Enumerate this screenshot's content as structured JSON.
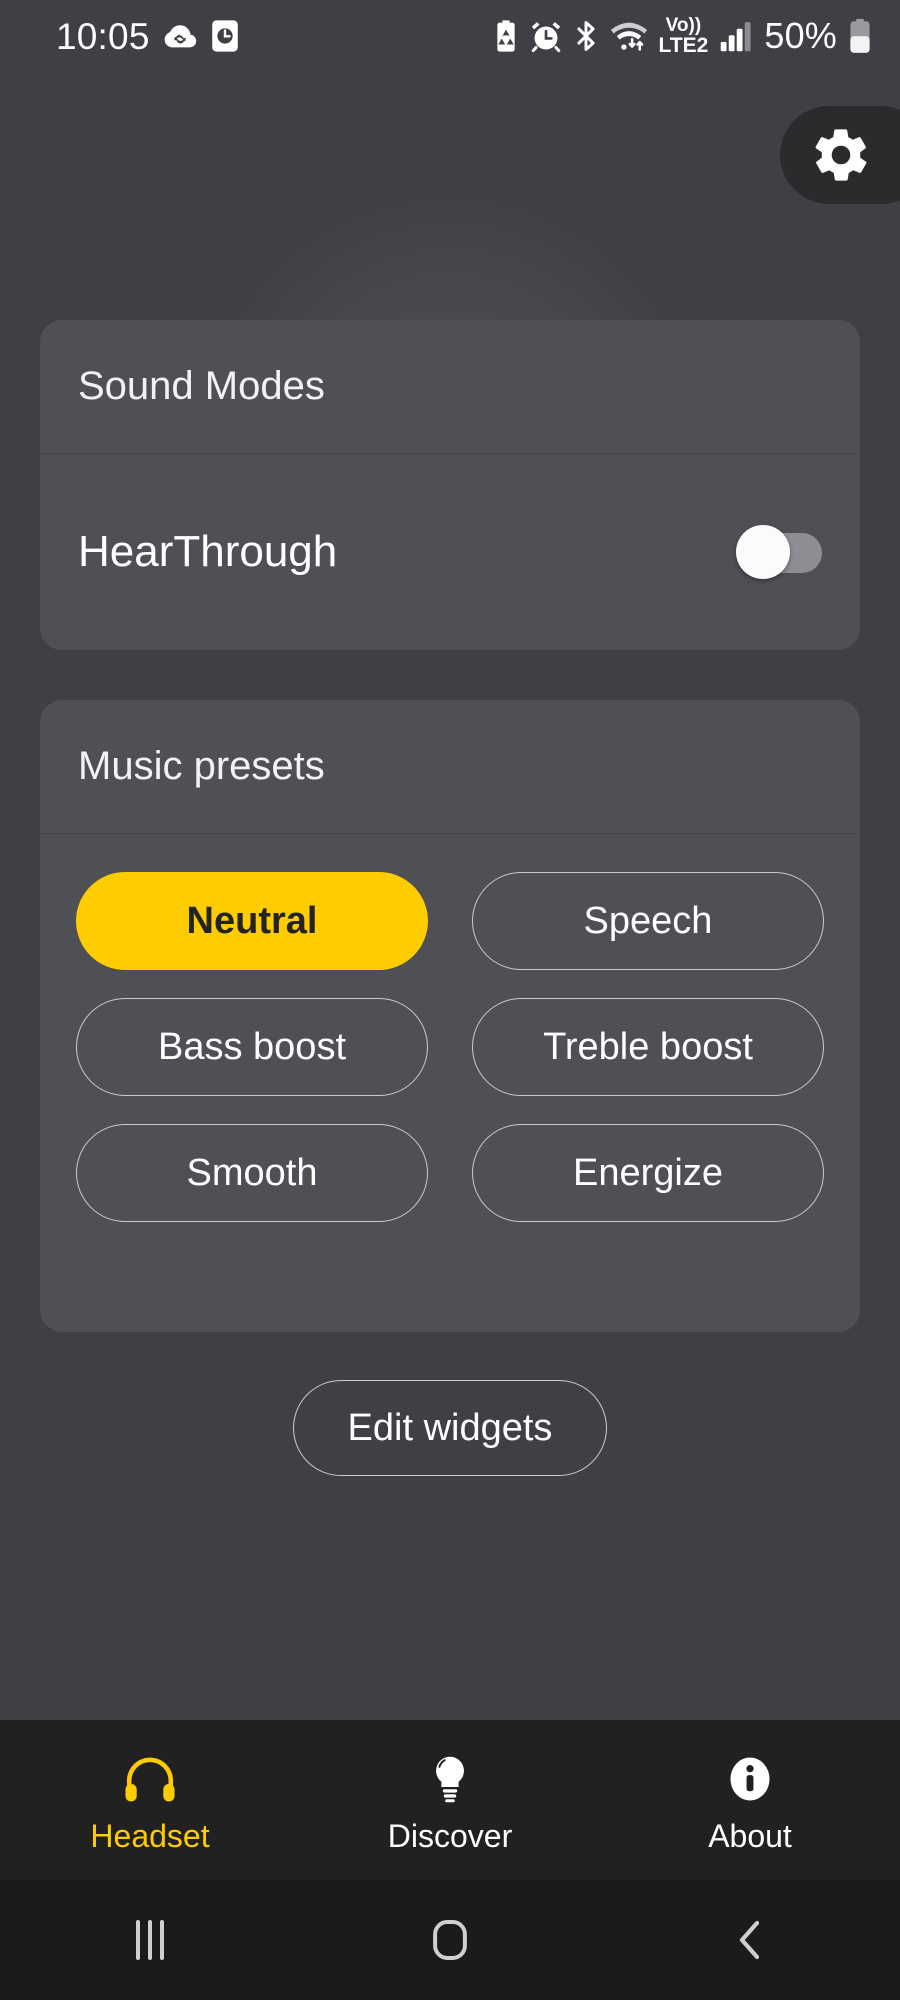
{
  "status_bar": {
    "time": "10:05",
    "battery_percent": "50%",
    "network_label": "LTE2",
    "volte_label": "Vo))",
    "left_icons": [
      "cloud-sync-icon",
      "screen-recorder-icon"
    ],
    "right_icons": [
      "battery-saver-icon",
      "alarm-icon",
      "bluetooth-icon",
      "wifi-icon",
      "volte-icon",
      "signal-bars-icon",
      "battery-icon"
    ]
  },
  "header": {
    "settings_icon": "gear-icon",
    "hero_image": "headset-hero-image"
  },
  "sound_modes": {
    "title": "Sound Modes",
    "hearthrough": {
      "label": "HearThrough",
      "enabled": false
    }
  },
  "music_presets": {
    "title": "Music presets",
    "selected": "Neutral",
    "items": [
      {
        "label": "Neutral",
        "selected": true
      },
      {
        "label": "Speech",
        "selected": false
      },
      {
        "label": "Bass boost",
        "selected": false
      },
      {
        "label": "Treble boost",
        "selected": false
      },
      {
        "label": "Smooth",
        "selected": false
      },
      {
        "label": "Energize",
        "selected": false
      }
    ]
  },
  "edit_widgets": {
    "label": "Edit widgets"
  },
  "tabs": [
    {
      "label": "Headset",
      "icon": "headphones-icon",
      "active": true
    },
    {
      "label": "Discover",
      "icon": "lightbulb-icon",
      "active": false
    },
    {
      "label": "About",
      "icon": "info-circle-icon",
      "active": false
    }
  ],
  "navigation_bar": {
    "recents": "recents-icon",
    "home": "home-icon",
    "back": "back-icon"
  },
  "colors": {
    "background": "#3e4045",
    "card": "#4f5055",
    "accent": "#ffcc00",
    "tabbar": "#212121",
    "navbar": "#1b1b1b",
    "outline": "#c9cace"
  }
}
